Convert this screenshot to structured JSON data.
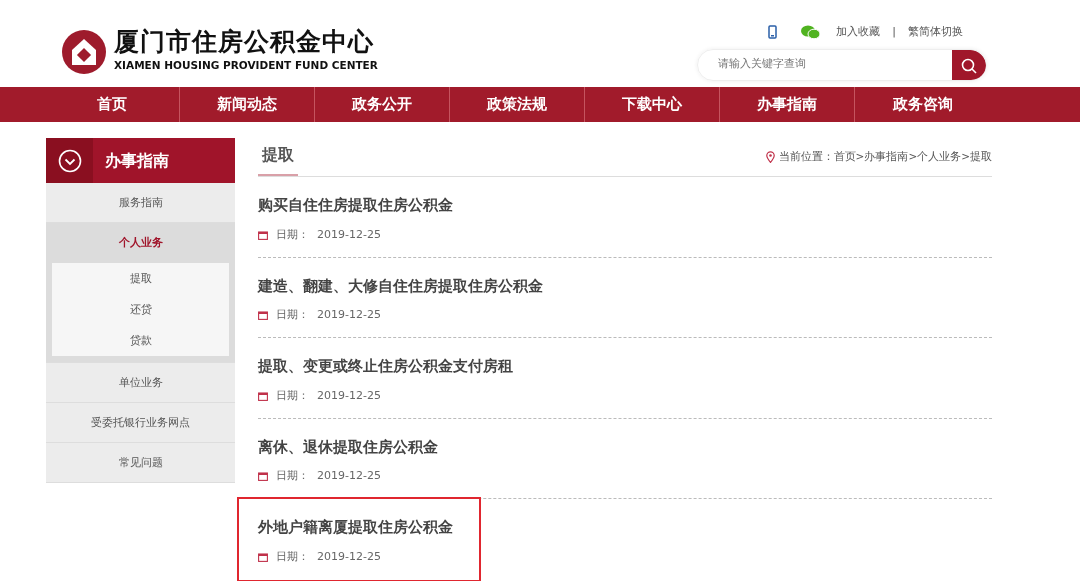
{
  "header": {
    "title": "厦门市住房公积金中心",
    "subtitle": "XIAMEN HOUSING PROVIDENT FUND CENTER",
    "links": [
      "加入收藏",
      "繁简体切换"
    ],
    "separator": "|",
    "search": {
      "placeholder": "请输入关键字查询"
    }
  },
  "nav": [
    "首页",
    "新闻动态",
    "政务公开",
    "政策法规",
    "下载中心",
    "办事指南",
    "政务咨询"
  ],
  "sidebar": {
    "title": "办事指南",
    "items": [
      {
        "label": "服务指南",
        "selected": false
      },
      {
        "label": "个人业务",
        "selected": true,
        "children": [
          {
            "label": "提取"
          },
          {
            "label": "还贷"
          },
          {
            "label": "贷款"
          }
        ]
      },
      {
        "label": "单位业务",
        "selected": false
      },
      {
        "label": "受委托银行业务网点",
        "selected": false
      },
      {
        "label": "常见问题",
        "selected": false
      }
    ]
  },
  "content": {
    "heading": "提取",
    "breadcrumb": "当前位置：首页>办事指南>个人业务>提取",
    "articles": [
      {
        "title": "购买自住住房提取住房公积金",
        "date_label": "日期：",
        "date": "2019-12-25",
        "highlighted": false
      },
      {
        "title": "建造、翻建、大修自住住房提取住房公积金",
        "date_label": "日期：",
        "date": "2019-12-25",
        "highlighted": false
      },
      {
        "title": "提取、变更或终止住房公积金支付房租",
        "date_label": "日期：",
        "date": "2019-12-25",
        "highlighted": false
      },
      {
        "title": "离休、退休提取住房公积金",
        "date_label": "日期：",
        "date": "2019-12-25",
        "highlighted": false
      },
      {
        "title": "外地户籍离厦提取住房公积金",
        "date_label": "日期：",
        "date": "2019-12-25",
        "highlighted": true
      }
    ]
  }
}
